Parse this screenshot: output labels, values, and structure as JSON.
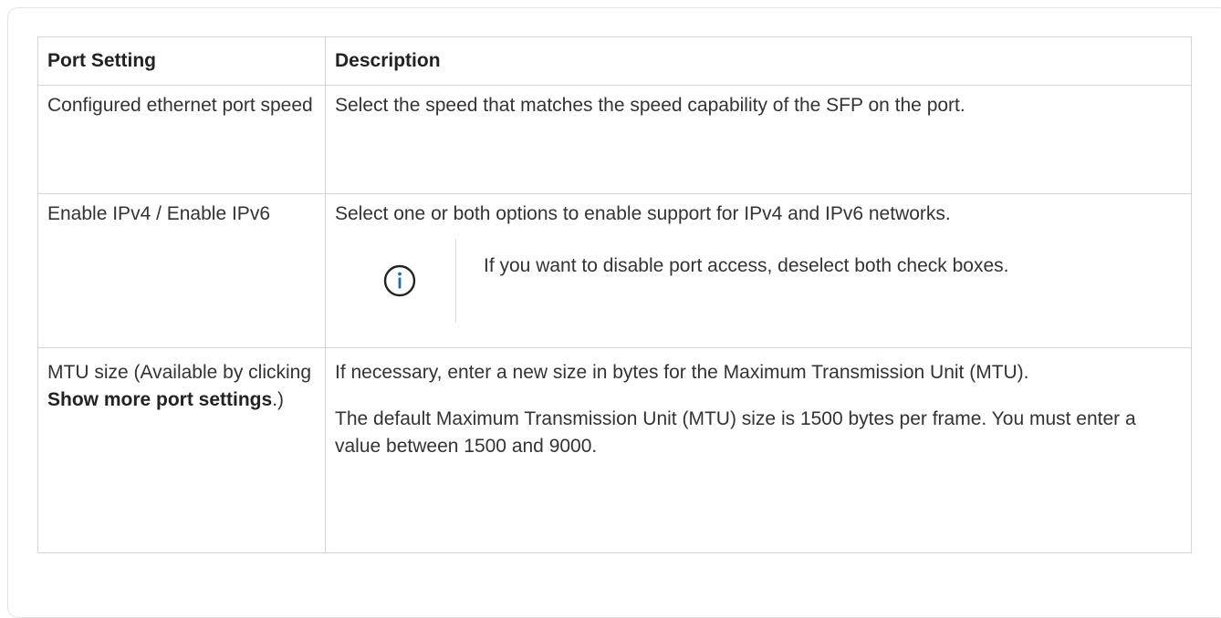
{
  "table": {
    "headers": {
      "setting": "Port Setting",
      "description": "Description"
    },
    "rows": [
      {
        "setting": "Configured ethernet port speed",
        "description": "Select the speed that matches the speed capability of the SFP on the port."
      },
      {
        "setting": "Enable IPv4 / Enable IPv6",
        "description": "Select one or both options to enable support for IPv4 and IPv6 networks.",
        "note_icon": "info-icon",
        "note": "If you want to disable port access, deselect both check boxes."
      },
      {
        "setting_prefix": "MTU size (Available by clicking ",
        "setting_bold": "Show more port settings",
        "setting_suffix": ".)",
        "description_1": "If necessary, enter a new size in bytes for the Maximum Transmission Unit (MTU).",
        "description_2": "The default Maximum Transmission Unit (MTU) size is 1500 bytes per frame. You must enter a value between 1500 and 9000."
      }
    ]
  },
  "colors": {
    "info_icon": "#1a6fa8",
    "border": "#d4d4d4",
    "text": "#333333"
  }
}
